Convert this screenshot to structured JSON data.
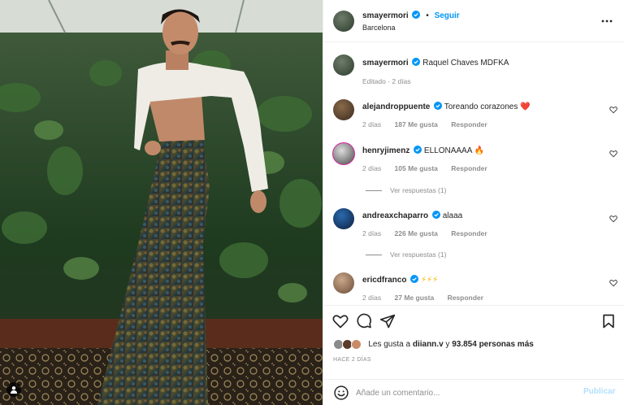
{
  "colors": {
    "accent": "#0095f6",
    "like_red": "#ed4956",
    "muted": "#8e8e8e",
    "text": "#262626"
  },
  "post": {
    "image_alt": "Photo of a man in a white cropped top and patterned flared trousers in front of a plant wall",
    "header": {
      "username": "smayermori",
      "separator": "•",
      "follow_label": "Seguir",
      "location": "Barcelona",
      "more_icon": "more-horizontal-icon"
    },
    "caption": {
      "username": "smayermori",
      "text": "Raquel Chaves MDFKA",
      "meta": "Editado · 2 días"
    },
    "comments": [
      {
        "username": "alejandroppuente",
        "text": "Toreando corazones",
        "emoji": "❤️",
        "time": "2 días",
        "likes": "187 Me gusta",
        "reply": "Responder"
      },
      {
        "username": "henryjimenz",
        "text": "ELLONAAAA",
        "emoji": "🔥",
        "time": "2 días",
        "likes": "105 Me gusta",
        "reply": "Responder",
        "view_replies": "Ver respuestas (1)"
      },
      {
        "username": "andreaxchaparro",
        "text": "alaaa",
        "emoji": "",
        "time": "2 días",
        "likes": "226 Me gusta",
        "reply": "Responder",
        "view_replies": "Ver respuestas (1)"
      },
      {
        "username": "ericdfranco",
        "text": "⚡⚡⚡",
        "emoji": "",
        "time": "2 días",
        "likes": "27 Me gusta",
        "reply": "Responder"
      }
    ],
    "likes_prefix": "Les gusta a",
    "likes_user": "diiann.v",
    "likes_conj": "y",
    "likes_count": "93.854 personas más",
    "time_ago": "HACE 2 DÍAS",
    "composer": {
      "placeholder": "Añade un comentario...",
      "publish_label": "Publicar"
    }
  }
}
